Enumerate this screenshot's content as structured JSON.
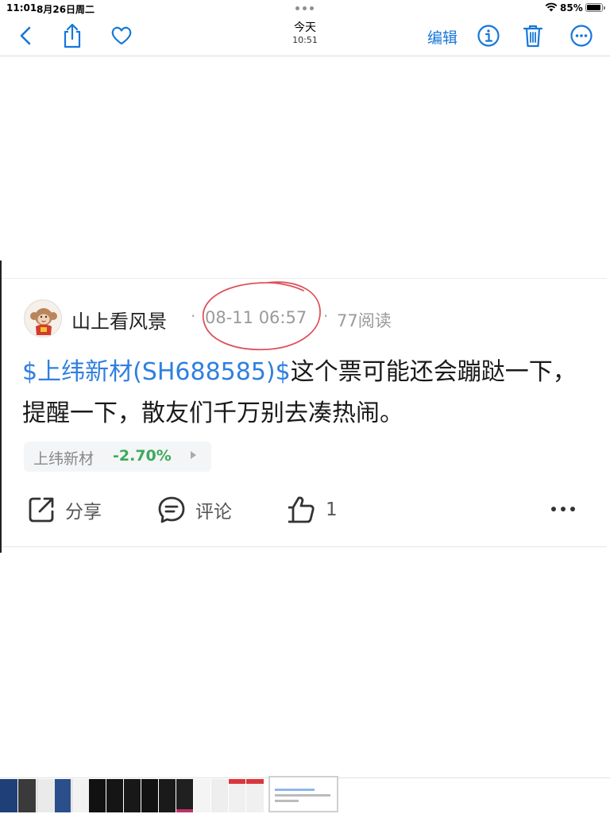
{
  "status_bar": {
    "time": "11:01",
    "date": "8月26日周二",
    "battery": "85%"
  },
  "nav": {
    "title": "今天",
    "subtitle": "10:51",
    "edit_label": "编辑",
    "icons": [
      "back-icon",
      "share-icon",
      "heart-icon",
      "info-icon",
      "trash-icon",
      "more-icon"
    ],
    "accent": "#1677d9"
  },
  "post": {
    "author": "山上看风景",
    "time": "08-11 06:57",
    "reads": "77阅读",
    "stock_link": "$上纬新材(SH688585)$",
    "body": "这个票可能还会蹦跶一下，提醒一下，散友们千万别去凑热闹。",
    "stock_tag": {
      "name": "上纬新材",
      "change": "-2.70%",
      "change_color": "#3daa5b"
    },
    "actions": {
      "share": "分享",
      "comment": "评论",
      "like_count": "1"
    },
    "link_color": "#2f7fe0",
    "annotation_color": "#e0505a"
  },
  "thumbnail_strip": {
    "items": 16
  }
}
